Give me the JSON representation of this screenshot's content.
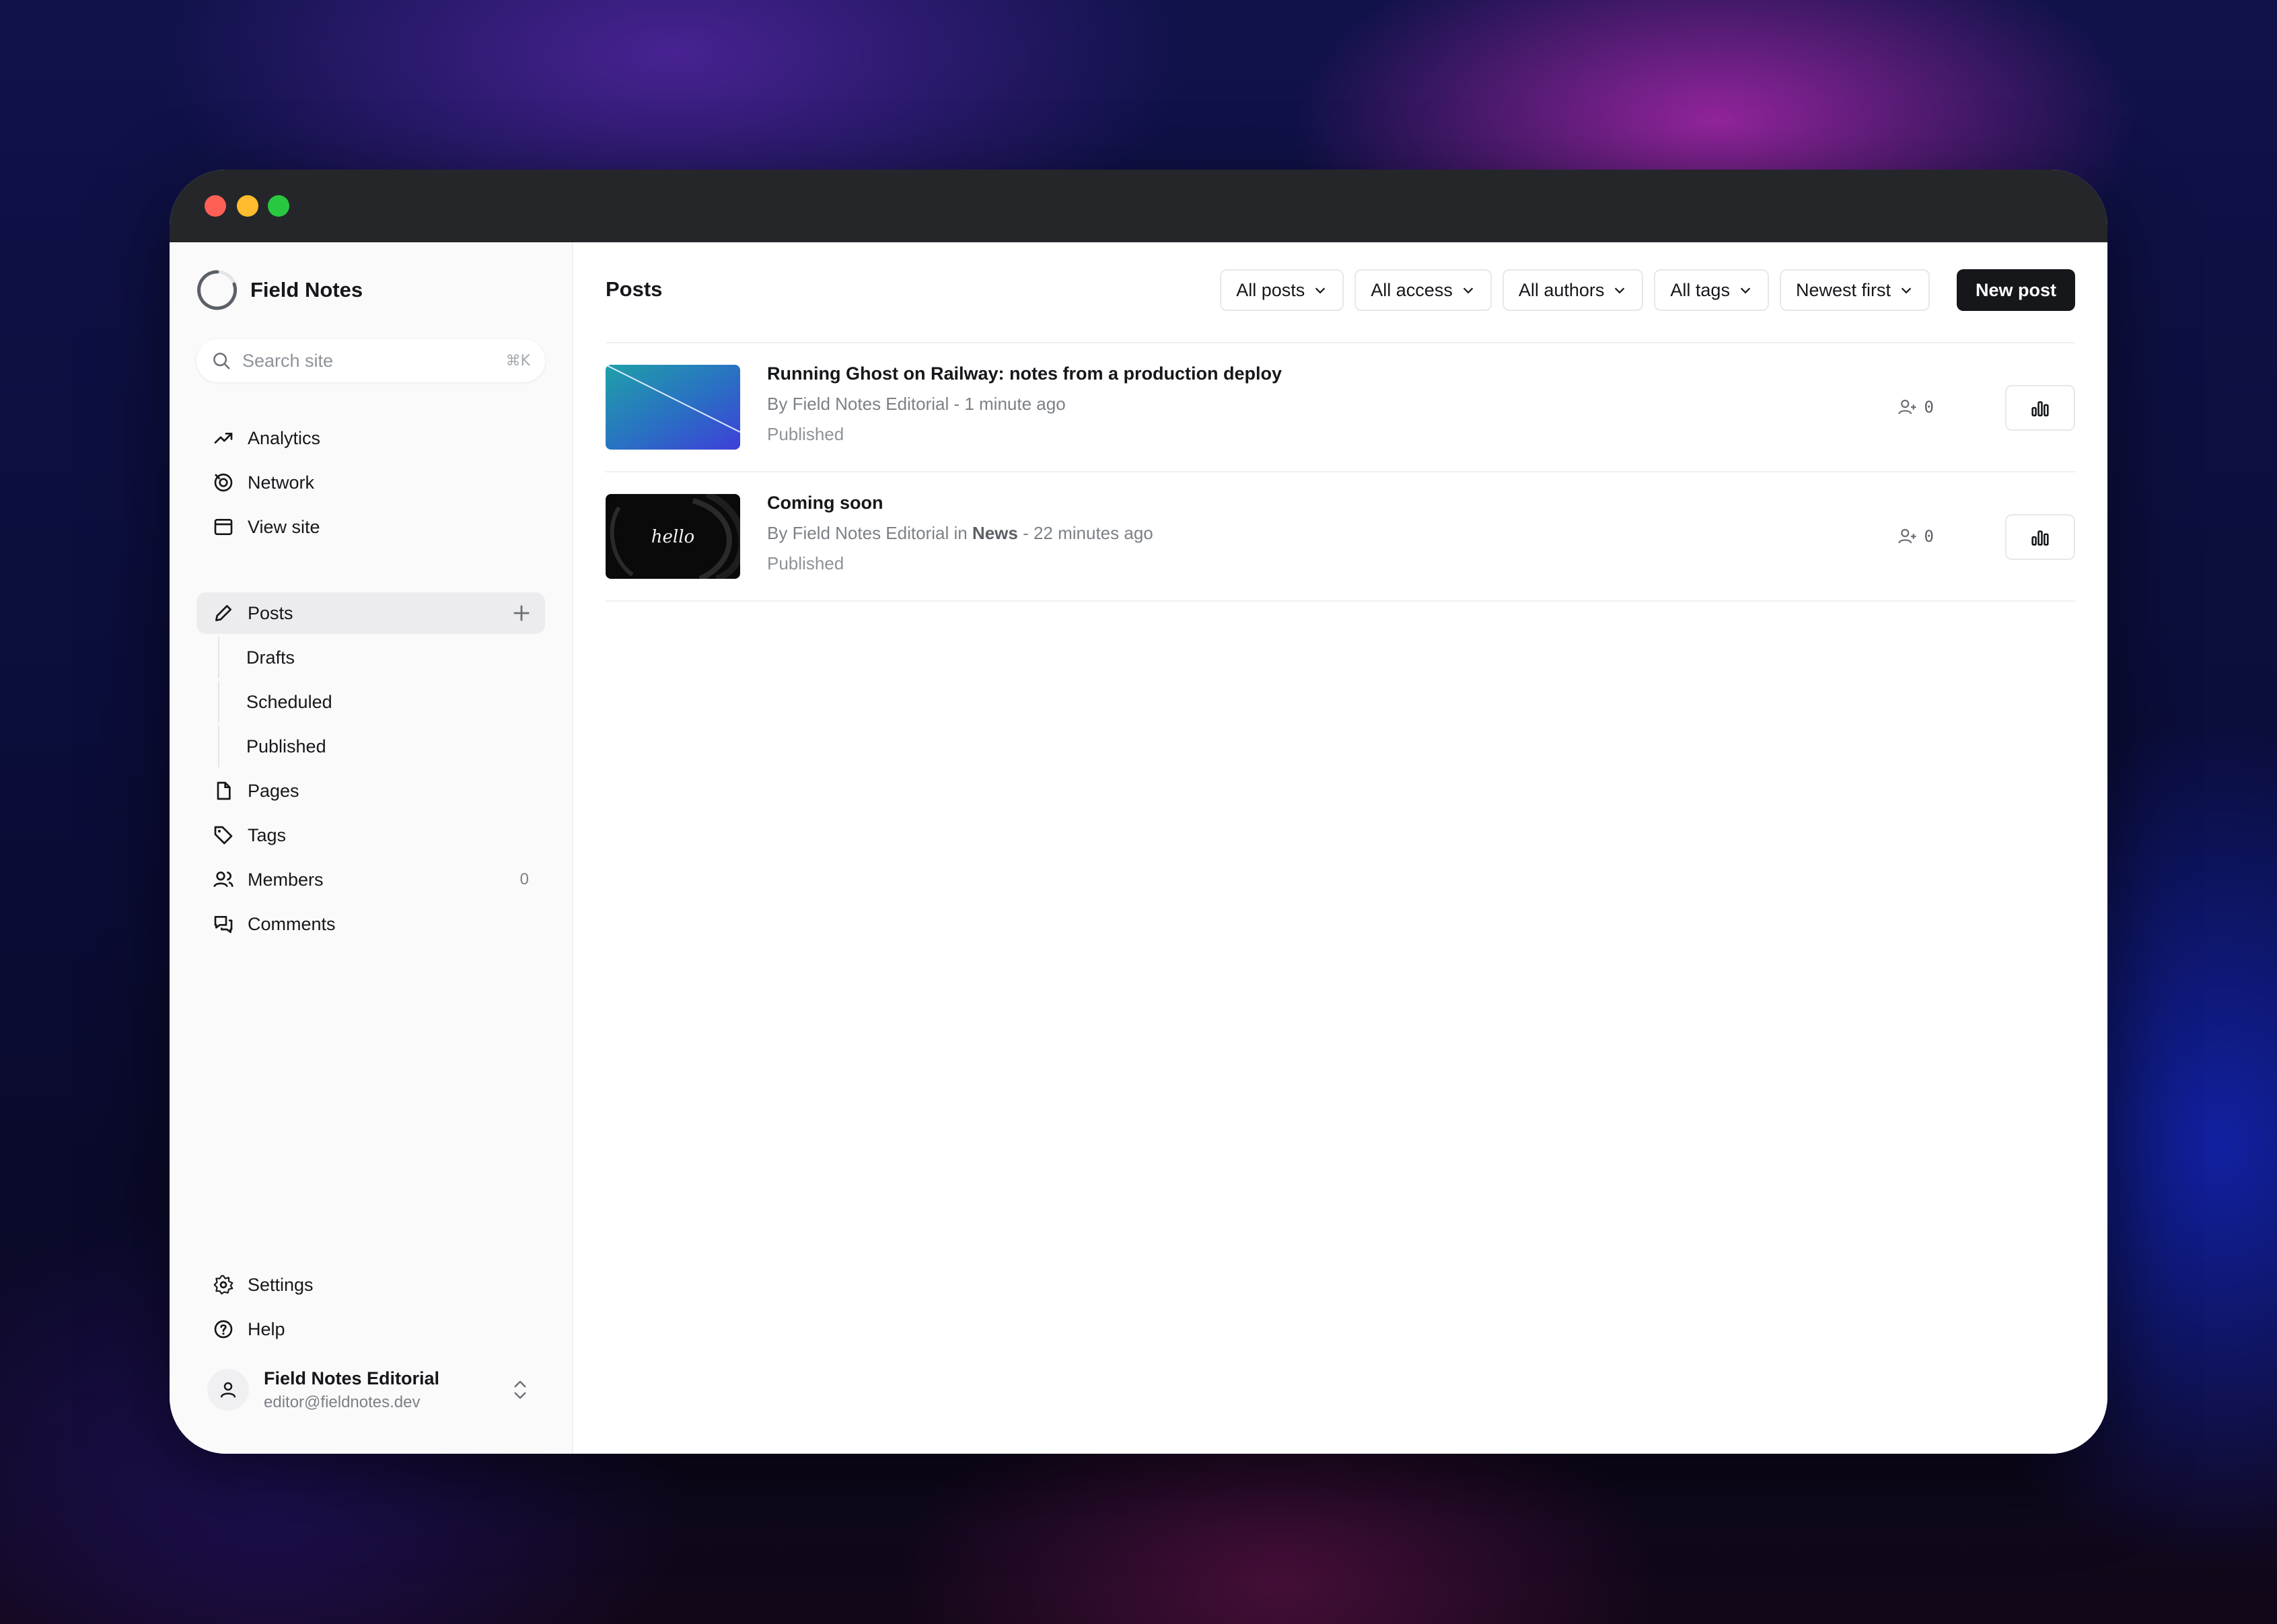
{
  "brand": {
    "name": "Field Notes"
  },
  "search": {
    "placeholder": "Search site",
    "shortcut": "⌘K"
  },
  "nav": {
    "analytics": "Analytics",
    "network": "Network",
    "view_site": "View site",
    "posts": "Posts",
    "drafts": "Drafts",
    "scheduled": "Scheduled",
    "published": "Published",
    "pages": "Pages",
    "tags": "Tags",
    "members": "Members",
    "members_count": "0",
    "comments": "Comments",
    "settings": "Settings",
    "help": "Help"
  },
  "user": {
    "name": "Field Notes Editorial",
    "email": "editor@fieldnotes.dev"
  },
  "main": {
    "title": "Posts",
    "filters": [
      "All posts",
      "All access",
      "All authors",
      "All tags",
      "Newest first"
    ],
    "new_post": "New post"
  },
  "posts": [
    {
      "title": "Running Ghost on Railway: notes from a production deploy",
      "meta_prefix": "By Field Notes Editorial",
      "tag_in": "",
      "tag": "",
      "time": " - 1 minute ago",
      "status": "Published",
      "members": "0",
      "thumb_icon": "gradient-image"
    },
    {
      "title": "Coming soon",
      "meta_prefix": "By Field Notes Editorial",
      "tag_in": " in ",
      "tag": "News",
      "time": " - 22 minutes ago",
      "status": "Published",
      "members": "0",
      "thumb_icon": "hello-image",
      "thumb_text": "hello"
    }
  ],
  "colors": {
    "primary_button": "#15171a",
    "sidebar_bg": "#fafafa",
    "titlebar": "#25262a"
  }
}
